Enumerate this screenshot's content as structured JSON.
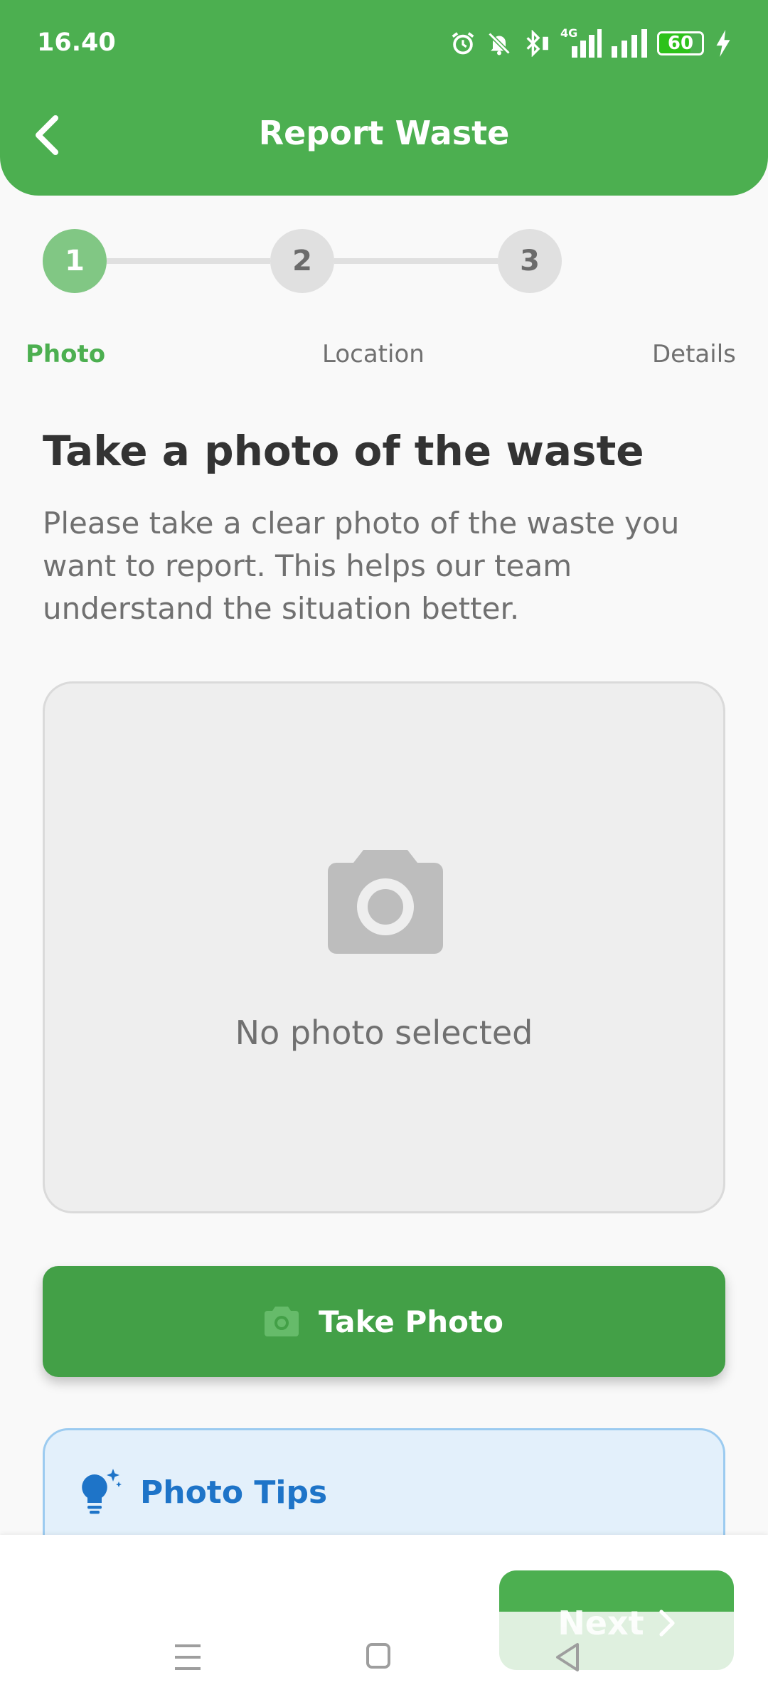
{
  "status_bar": {
    "time": "16.40",
    "network": "4G",
    "battery": "60",
    "icons": [
      "alarm-icon",
      "bell-off-icon",
      "bluetooth-icon",
      "signal-icon",
      "signal-icon",
      "battery-icon",
      "charging-icon"
    ]
  },
  "header": {
    "title": "Report Waste",
    "back_icon": "chevron-left-icon"
  },
  "stepper": {
    "steps": [
      {
        "number": "1",
        "label": "Photo",
        "active": true
      },
      {
        "number": "2",
        "label": "Location",
        "active": false
      },
      {
        "number": "3",
        "label": "Details",
        "active": false
      }
    ]
  },
  "content": {
    "heading": "Take a photo of the waste",
    "description": "Please take a clear photo of the waste you want to report. This helps our team understand the situation better.",
    "placeholder_text": "No photo selected",
    "take_photo_label": "Take Photo",
    "tips_title": "Photo Tips"
  },
  "footer": {
    "next_label": "Next"
  },
  "colors": {
    "primary": "#4caf50",
    "button": "#43a047",
    "tips_background": "#e3f0fb",
    "tips_text": "#1e74c8"
  }
}
